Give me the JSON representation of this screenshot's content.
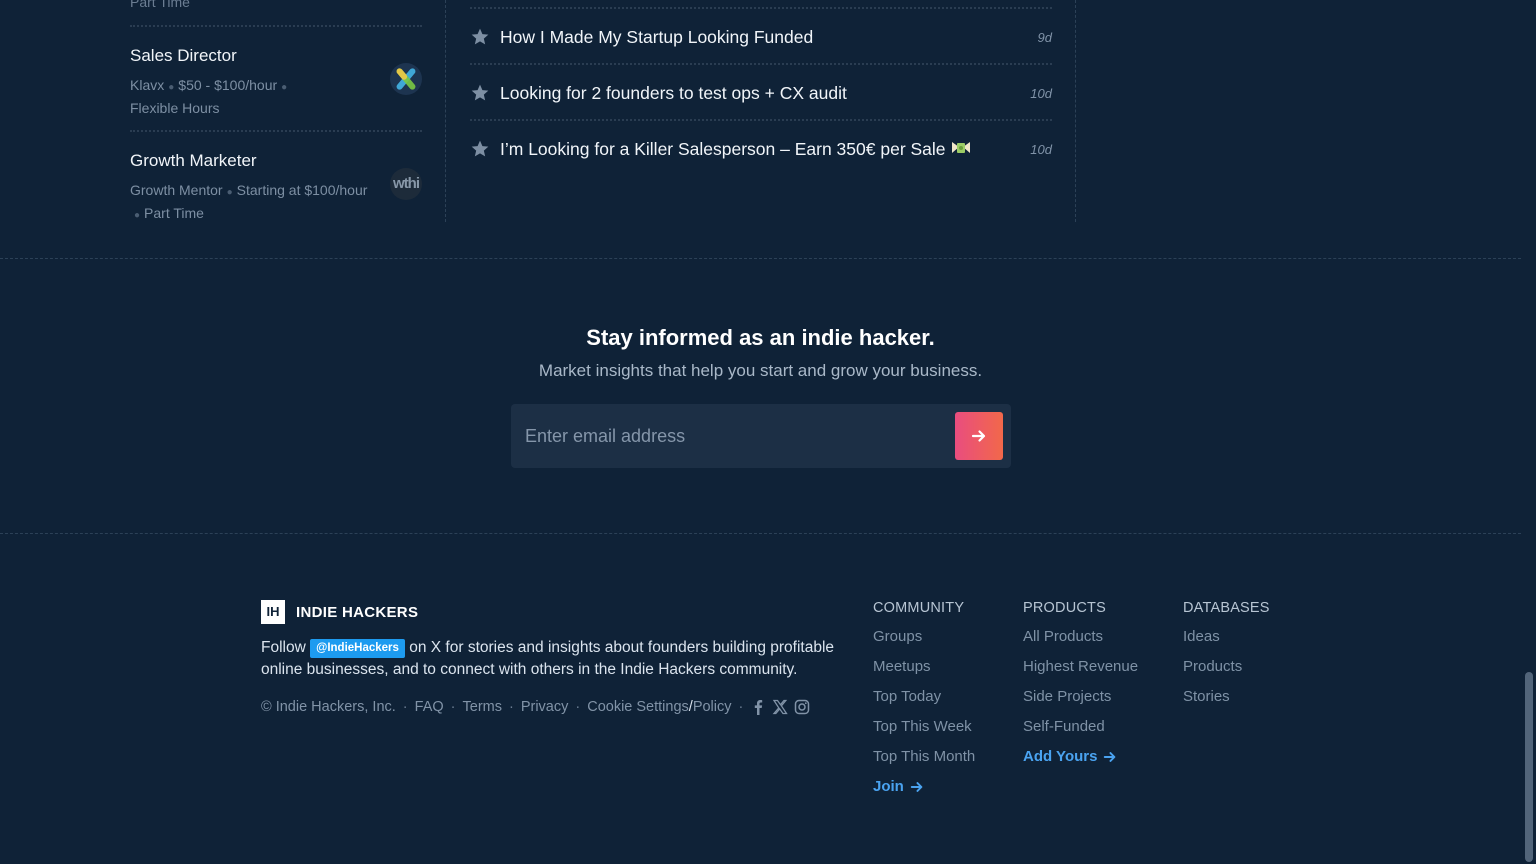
{
  "jobs": {
    "partial_meta": "Part Time",
    "items": [
      {
        "title": "Sales Director",
        "meta_line1": [
          "Klavx",
          "$50 - $100/hour"
        ],
        "meta_line2": "Flexible Hours"
      },
      {
        "title": "Growth Marketer",
        "meta_line1": [
          "Growth Mentor",
          "Starting at $100/hour"
        ],
        "meta_line2": "Part Time",
        "logo_text": "wthi"
      }
    ]
  },
  "posts": [
    {
      "title": "How I Made My Startup Looking Funded",
      "time": "9d"
    },
    {
      "title": "Looking for 2 founders to test ops + CX audit",
      "time": "10d"
    },
    {
      "title": "I’m Looking for a Killer Salesperson – Earn 350€ per Sale",
      "time": "10d"
    }
  ],
  "newsletter": {
    "heading": "Stay informed as an indie hacker.",
    "subheading": "Market insights that help you start and grow your business.",
    "email_placeholder": "Enter email address"
  },
  "footer": {
    "logo_text": "IH",
    "brand": "INDIE HACKERS",
    "about_prefix": "Follow",
    "handle": "@IndieHackers",
    "about_suffix": "on X for stories and insights about founders building profitable online businesses, and to connect with others in the Indie Hackers community.",
    "copyright": "© Indie Hackers, Inc.",
    "faq": "FAQ",
    "terms": "Terms",
    "privacy": "Privacy",
    "cookie_settings": "Cookie Settings",
    "slash": "/",
    "policy": "Policy",
    "columns": {
      "community": {
        "heading": "COMMUNITY",
        "links": [
          "Groups",
          "Meetups",
          "Top Today",
          "Top This Week",
          "Top This Month"
        ],
        "cta": "Join"
      },
      "products": {
        "heading": "PRODUCTS",
        "links": [
          "All Products",
          "Highest Revenue",
          "Side Projects",
          "Self-Funded"
        ],
        "cta": "Add Yours"
      },
      "databases": {
        "heading": "DATABASES",
        "links": [
          "Ideas",
          "Products",
          "Stories"
        ]
      }
    }
  },
  "colors": {
    "background": "#0f2237",
    "accent_link": "#4aa3f0",
    "cta_gradient_start": "#e94d7f",
    "cta_gradient_end": "#f2684a",
    "handle_badge": "#1d9bf0"
  }
}
